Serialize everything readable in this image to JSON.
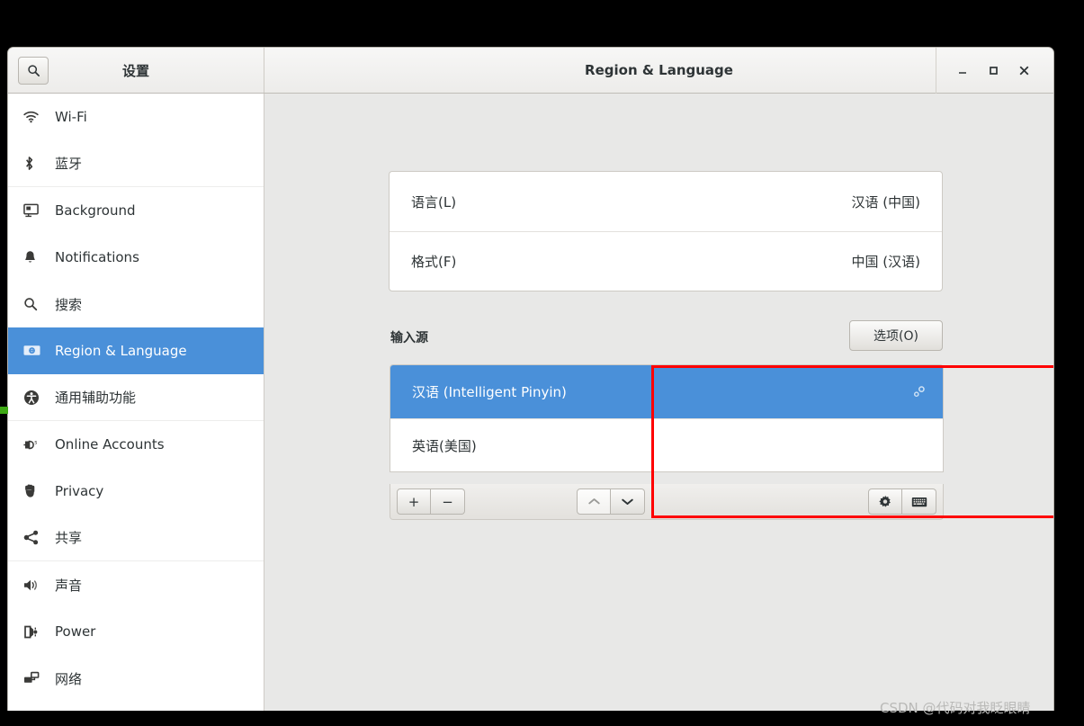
{
  "window": {
    "app_title": "设置",
    "page_title": "Region & Language",
    "controls": {
      "minimize": "minimize-icon",
      "maximize": "maximize-icon",
      "close": "close-icon"
    },
    "search_icon": "search-icon"
  },
  "sidebar": {
    "items": [
      {
        "label": "Wi-Fi",
        "icon": "wifi-icon",
        "selected": false,
        "separator_after": false
      },
      {
        "label": "蓝牙",
        "icon": "bluetooth-icon",
        "selected": false,
        "separator_after": true
      },
      {
        "label": "Background",
        "icon": "background-icon",
        "selected": false,
        "separator_after": false
      },
      {
        "label": "Notifications",
        "icon": "bell-icon",
        "selected": false,
        "separator_after": false
      },
      {
        "label": "搜索",
        "icon": "search-icon",
        "selected": false,
        "separator_after": false
      },
      {
        "label": "Region & Language",
        "icon": "region-language-icon",
        "selected": true,
        "separator_after": false
      },
      {
        "label": "通用辅助功能",
        "icon": "accessibility-icon",
        "selected": false,
        "separator_after": true
      },
      {
        "label": "Online Accounts",
        "icon": "online-accounts-icon",
        "selected": false,
        "separator_after": false
      },
      {
        "label": "Privacy",
        "icon": "privacy-hand-icon",
        "selected": false,
        "separator_after": false
      },
      {
        "label": "共享",
        "icon": "sharing-icon",
        "selected": false,
        "separator_after": true
      },
      {
        "label": "声音",
        "icon": "sound-icon",
        "selected": false,
        "separator_after": false
      },
      {
        "label": "Power",
        "icon": "power-icon",
        "selected": false,
        "separator_after": false
      },
      {
        "label": "网络",
        "icon": "network-icon",
        "selected": false,
        "separator_after": false
      }
    ]
  },
  "main": {
    "language_rows": [
      {
        "label": "语言(L)",
        "value": "汉语 (中国)"
      },
      {
        "label": "格式(F)",
        "value": "中国 (汉语)"
      }
    ],
    "input_sources": {
      "heading": "输入源",
      "options_button": "选项(O)",
      "rows": [
        {
          "label": "汉语 (Intelligent Pinyin)",
          "selected": true,
          "gear": "preferences-gear-icon"
        },
        {
          "label": "英语(美国)",
          "selected": false,
          "gear": null
        }
      ],
      "toolbar": {
        "add": "+",
        "remove": "−",
        "move_up": "⌃",
        "move_down": "⌄",
        "settings": "gear-icon",
        "keyboard": "keyboard-icon"
      }
    }
  },
  "annotation": {
    "highlight_color": "#ff0000"
  },
  "watermark": {
    "text": "CSDN @代码对我眨眼睛"
  },
  "colors": {
    "selection_blue": "#4a90d9",
    "window_bg": "#e8e8e7",
    "sidebar_bg": "#ffffff"
  }
}
